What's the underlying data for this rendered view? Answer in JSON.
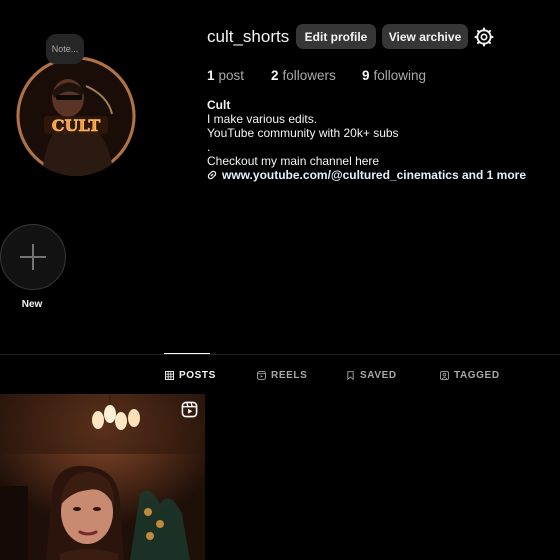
{
  "profile": {
    "note_label": "Note...",
    "username": "cult_shorts",
    "edit_profile_label": "Edit profile",
    "view_archive_label": "View archive",
    "posts_count": "1",
    "posts_label": "post",
    "followers_count": "2",
    "followers_label": "followers",
    "following_count": "9",
    "following_label": "following"
  },
  "bio": {
    "name": "Cult",
    "line1": "I make various edits.",
    "line2": "YouTube community with 20k+ subs",
    "line3": ".",
    "line4": "Checkout my main channel here",
    "link": "www.youtube.com/@cultured_cinematics and 1 more"
  },
  "highlights": {
    "new_label": "New"
  },
  "tabs": [
    {
      "label": "POSTS",
      "icon": "grid-icon"
    },
    {
      "label": "REELS",
      "icon": "reels-icon"
    },
    {
      "label": "SAVED",
      "icon": "bookmark-icon"
    },
    {
      "label": "TAGGED",
      "icon": "tag-icon"
    }
  ],
  "avatar_badge_text": "CULT"
}
